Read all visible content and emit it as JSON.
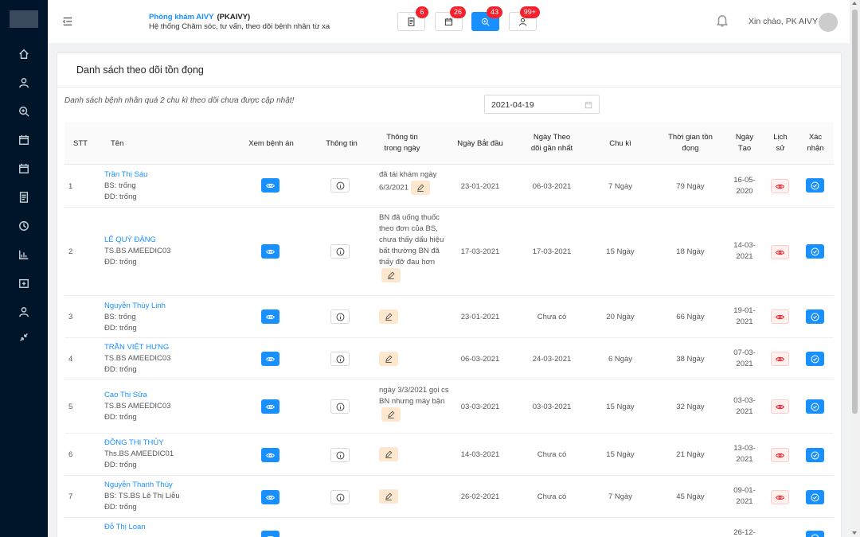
{
  "sidebar": {
    "icons": [
      "home-icon",
      "user-icon",
      "search-plus-icon",
      "calendar-icon",
      "calendar-icon",
      "file-list-icon",
      "history-icon",
      "bar-chart-icon",
      "medical-case-icon",
      "user-icon",
      "collapse-arrows-icon"
    ]
  },
  "header": {
    "clinic_name": "Phòng khám AIVY",
    "clinic_code": "(PKAIVY)",
    "subtitle": "Hệ thống Chăm sóc, tư vấn, theo dõi bệnh nhân từ xa",
    "badges": [
      "6",
      "26",
      "43",
      "99+"
    ],
    "greeting": "Xin chào, PK AIVY"
  },
  "card": {
    "title": "Danh sách theo dõi tồn đọng",
    "note": "Danh sách bệnh nhân quá 2 chu kì theo dõi chưa được cập nhật!",
    "date": "2021-04-19"
  },
  "table": {
    "headers": {
      "stt": "STT",
      "name": "Tên",
      "record": "Xem bệnh án",
      "info": "Thông tin",
      "daily_1": "Thông tin",
      "daily_2": "trong ngày",
      "start": "Ngày Bắt đầu",
      "latest_1": "Ngày Theo",
      "latest_2": "dõi gần nhất",
      "cycle": "Chu kì",
      "pending_1": "Thời gian tồn",
      "pending_2": "đọng",
      "created_1": "Ngày",
      "created_2": "Tạo",
      "history_1": "Lịch",
      "history_2": "sử",
      "confirm_1": "Xác",
      "confirm_2": "nhận"
    },
    "rows": [
      {
        "stt": "1",
        "name": "Trần Thị Sáu",
        "doctor": "BS: trống",
        "nurse": "ĐD: trống",
        "note": "đã tái khám ngày 6/3/2021",
        "start": "23-01-2021",
        "latest": "06-03-2021",
        "cycle": "7 Ngày",
        "pending": "79 Ngày",
        "created_1": "16-05-",
        "created_2": "2020"
      },
      {
        "stt": "2",
        "name": "LÊ QUÝ ĐẶNG",
        "doctor": "TS.BS AMEEDIC03",
        "nurse": "ĐD: trống",
        "note": "BN đã uống thuốc theo đơn của BS, chưa thấy dấu hiệu bất thường BN đã thấy đỡ đau hơn",
        "start": "17-03-2021",
        "latest": "17-03-2021",
        "cycle": "15 Ngày",
        "pending": "18 Ngày",
        "created_1": "14-03-",
        "created_2": "2021"
      },
      {
        "stt": "3",
        "name": "Nguyễn Thùy Linh",
        "doctor": "BS: trống",
        "nurse": "ĐD: trống",
        "note": "",
        "start": "23-01-2021",
        "latest": "Chưa có",
        "cycle": "20 Ngày",
        "pending": "66 Ngày",
        "created_1": "19-01-",
        "created_2": "2021"
      },
      {
        "stt": "4",
        "name": "TRẦN VIỆT HƯNG",
        "doctor": "TS.BS AMEEDIC03",
        "nurse": "ĐD: trống",
        "note": "",
        "start": "06-03-2021",
        "latest": "24-03-2021",
        "cycle": "6 Ngày",
        "pending": "38 Ngày",
        "created_1": "07-03-",
        "created_2": "2021"
      },
      {
        "stt": "5",
        "name": "Cao Thị Sửa",
        "doctor": "TS.BS AMEEDIC03",
        "nurse": "ĐD: trống",
        "note": "ngày 3/3/2021 gọi cs BN nhưng máy bận",
        "start": "03-03-2021",
        "latest": "03-03-2021",
        "cycle": "15 Ngày",
        "pending": "32 Ngày",
        "created_1": "03-03-",
        "created_2": "2021"
      },
      {
        "stt": "6",
        "name": "ĐỒNG THỊ THỦY",
        "doctor": "Ths.BS AMEEDIC01",
        "nurse": "ĐD: trống",
        "note": "",
        "start": "14-03-2021",
        "latest": "Chưa có",
        "cycle": "15 Ngày",
        "pending": "21 Ngày",
        "created_1": "13-03-",
        "created_2": "2021"
      },
      {
        "stt": "7",
        "name": "Nguyễn Thanh Thúy",
        "doctor": "BS: TS.BS Lê Thị Liễu",
        "nurse": "ĐD: trống",
        "note": "",
        "start": "26-02-2021",
        "latest": "Chưa có",
        "cycle": "7 Ngày",
        "pending": "45 Ngày",
        "created_1": "09-01-",
        "created_2": "2021"
      },
      {
        "stt": "8",
        "name": "Đỗ Thị Loan",
        "doctor": "",
        "nurse": "",
        "note": "",
        "start": "",
        "latest": "",
        "cycle": "",
        "pending": "",
        "created_1": "26-12-",
        "created_2": ""
      }
    ]
  }
}
